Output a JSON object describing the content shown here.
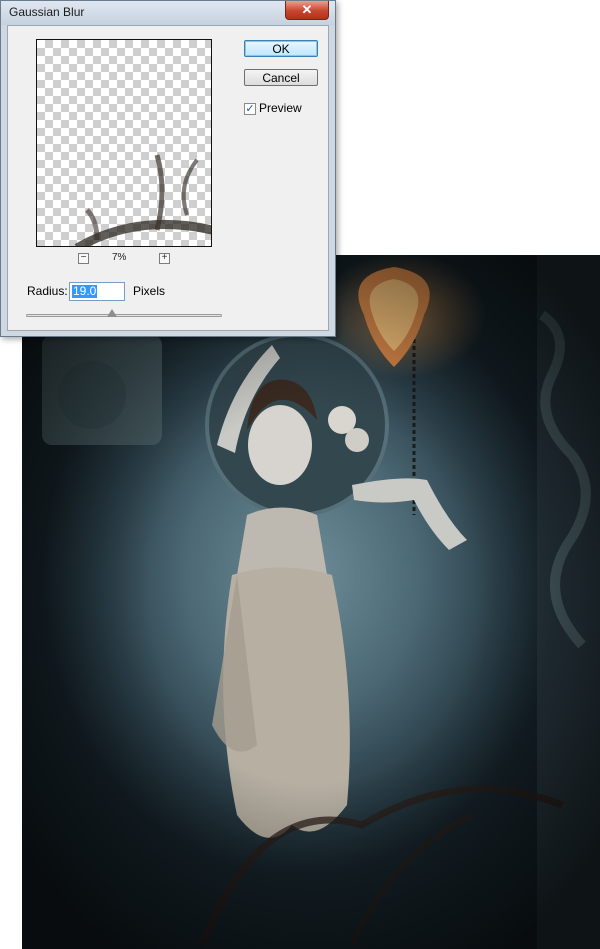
{
  "dialog": {
    "title": "Gaussian Blur",
    "close_glyph": "✕",
    "ok_label": "OK",
    "cancel_label": "Cancel",
    "preview_checked": true,
    "preview_check_glyph": "✓",
    "preview_label": "Preview",
    "zoom_out_glyph": "−",
    "zoom_in_glyph": "+",
    "zoom_level": "7%",
    "radius_label": "Radius:",
    "radius_value": "19.0",
    "radius_unit": "Pixels",
    "slider_fraction": 0.44
  },
  "colors": {
    "title_bar": "#c6d2df",
    "close_button": "#c7452f",
    "selection": "#3399ff"
  },
  "icons": [
    "close-icon",
    "checkmark-icon",
    "zoom-out-icon",
    "zoom-in-icon",
    "slider-thumb-icon"
  ]
}
